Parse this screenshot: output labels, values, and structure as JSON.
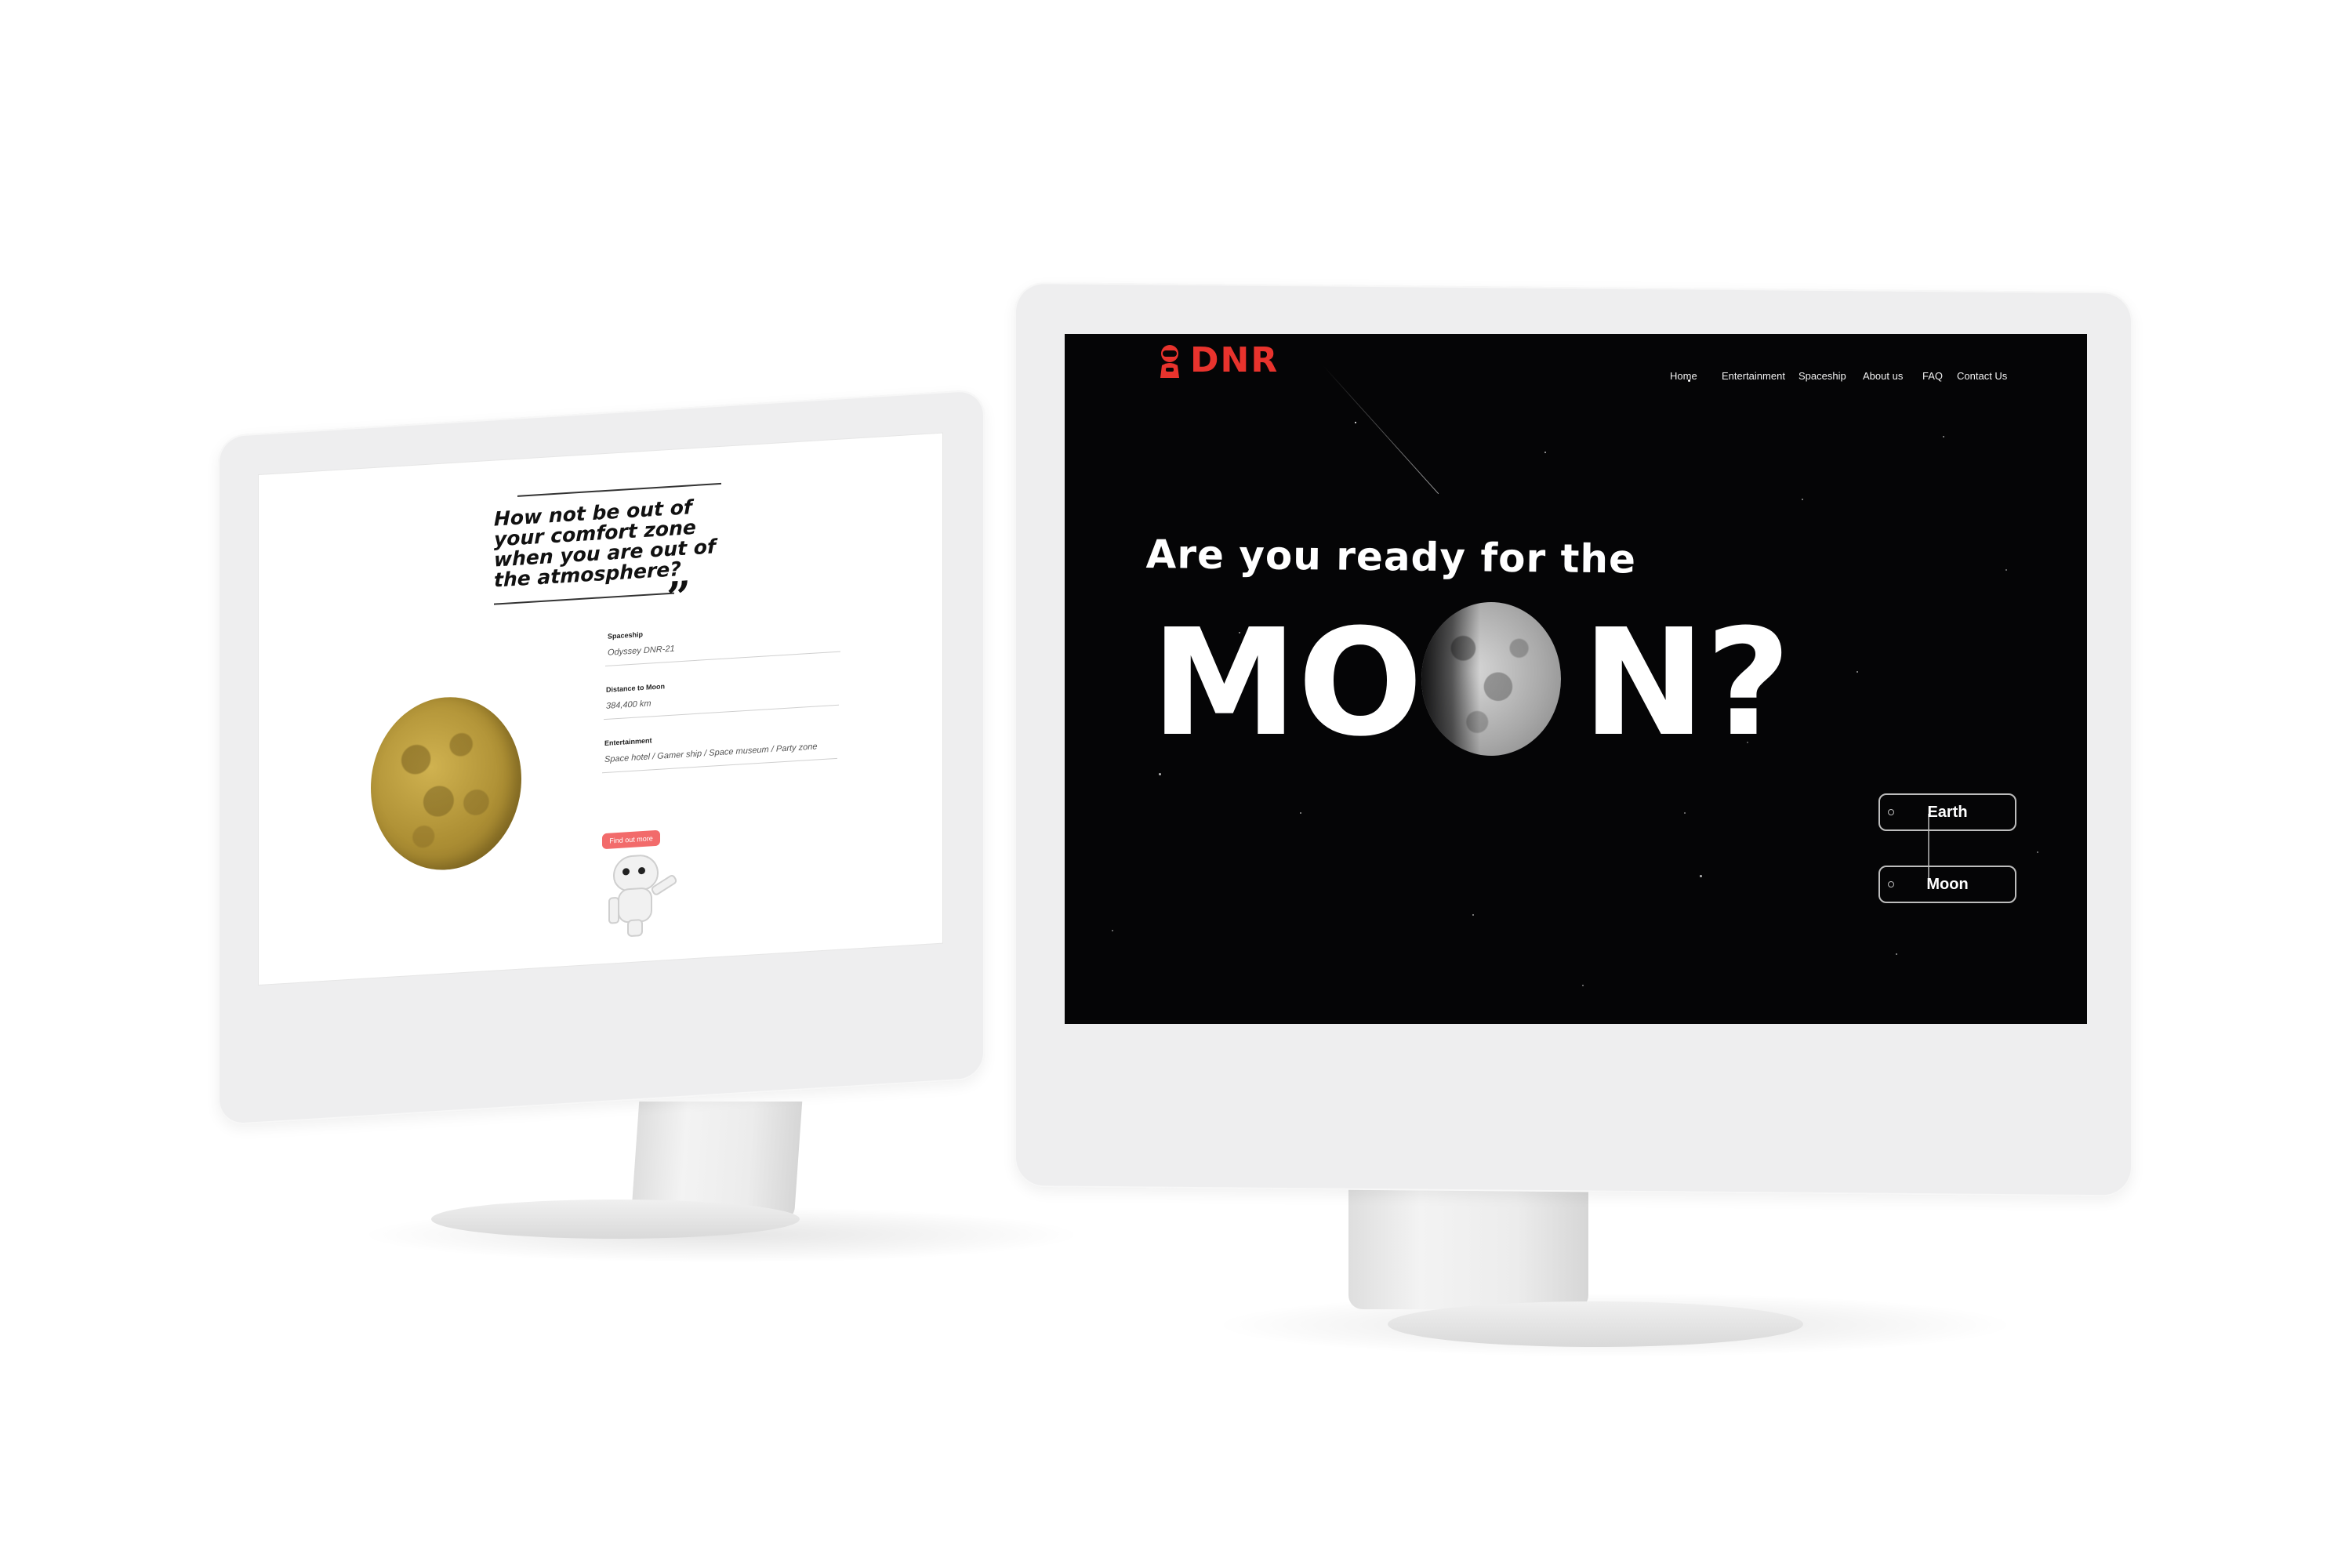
{
  "left_screen": {
    "quote": {
      "line1": "How not be out of",
      "line2": "your comfort zone",
      "line3": "when you are out of",
      "line4": "the atmosphere?",
      "closing_mark": "”"
    },
    "fields": [
      {
        "label": "Spaceship",
        "value": "Odyssey DNR-21"
      },
      {
        "label": "Distance to Moon",
        "value": "384,400 km"
      },
      {
        "label": "Entertainment",
        "value": "Space hotel / Gamer ship / Space museum / Party zone"
      }
    ],
    "cta_label": "Find out more"
  },
  "right_screen": {
    "logo_text": "DNR",
    "nav": [
      "Home",
      "Entertainment",
      "Spaceship",
      "About us",
      "FAQ",
      "Contact Us"
    ],
    "hero": {
      "line1": "Are you ready for the",
      "big_left": "MO",
      "big_right": "N?"
    },
    "toggles": [
      "Earth",
      "Moon"
    ]
  },
  "colors": {
    "brand_red": "#e8332d",
    "cta_coral": "#f26b6b",
    "hero_bg": "#050506",
    "moon_gold": "#b8963a"
  }
}
